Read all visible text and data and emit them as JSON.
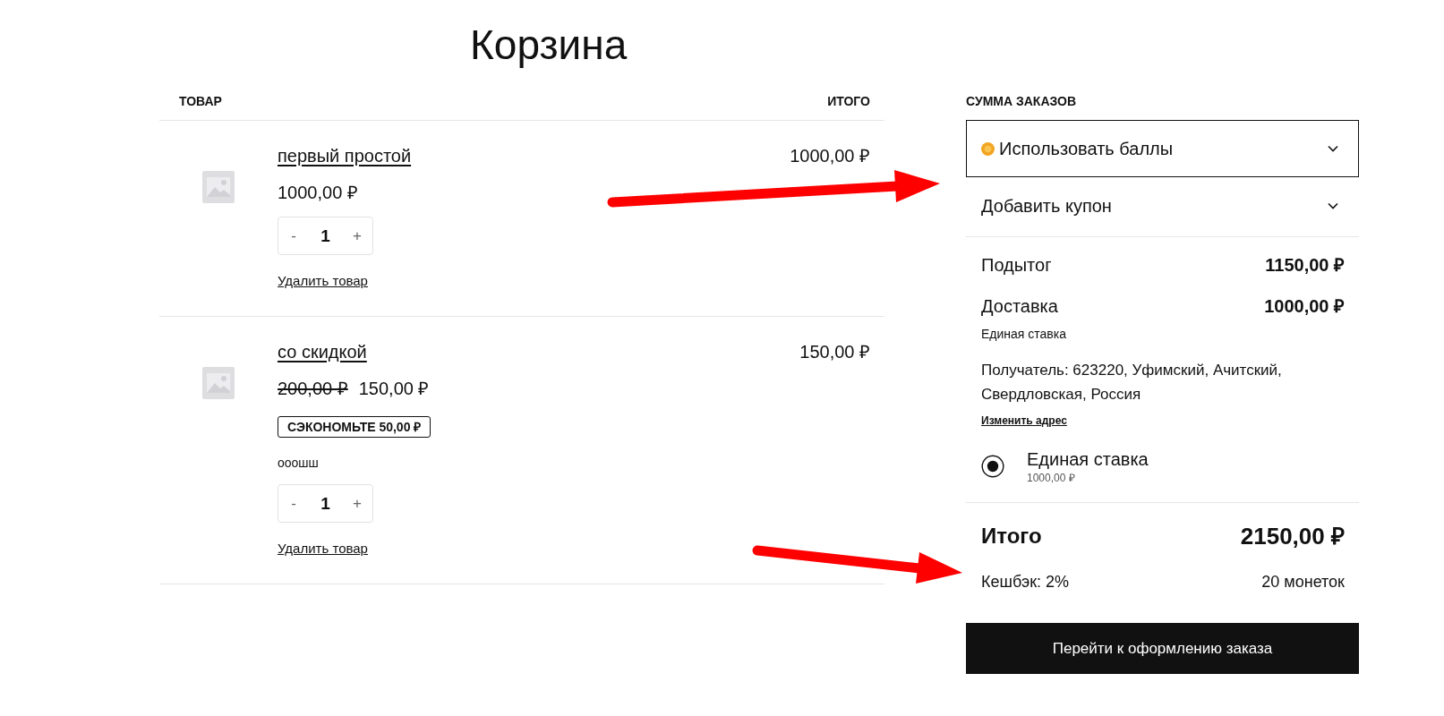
{
  "page": {
    "title": "Корзина"
  },
  "cart": {
    "columns": [
      "ТОВАР",
      "ИТОГО"
    ],
    "items": [
      {
        "name": "первый простой",
        "price": "1000,00 ₽",
        "decrement": "-",
        "quantity": "1",
        "increment": "+",
        "remove": "Удалить товар",
        "total": "1000,00 ₽"
      },
      {
        "name": "со скидкой",
        "old_price": "200,00 ₽",
        "price": "150,00 ₽",
        "badge": "СЭКОНОМЬТЕ 50,00 ₽",
        "note": "ооошш",
        "decrement": "-",
        "quantity": "1",
        "increment": "+",
        "remove": "Удалить товар",
        "total": "150,00 ₽"
      }
    ]
  },
  "summary": {
    "heading": "СУММА ЗАКАЗОВ",
    "accordions": [
      {
        "kind": "points",
        "label": "Использовать баллы",
        "focused": true,
        "expanded": false
      },
      {
        "kind": "coupon",
        "label": "Добавить купон",
        "focused": false,
        "expanded": false
      }
    ],
    "lines": [
      {
        "label": "Подытог",
        "value": "1150,00 ₽"
      },
      {
        "label": "Доставка",
        "value": "1000,00 ₽",
        "note": "Единая ставка"
      }
    ],
    "shipping": {
      "address": "Получатель: 623220, Уфимский, Ачитский, Свердловская, Россия",
      "change_link": "Изменить адрес",
      "options": [
        {
          "label": "Единая ставка",
          "price": "1000,00 ₽",
          "selected": true
        }
      ]
    },
    "total": {
      "label": "Итого",
      "value": "2150,00 ₽"
    },
    "cashback": {
      "label": "Кешбэк: 2%",
      "value": "20 монеток"
    },
    "checkout_button": "Перейти к оформлению заказа"
  }
}
